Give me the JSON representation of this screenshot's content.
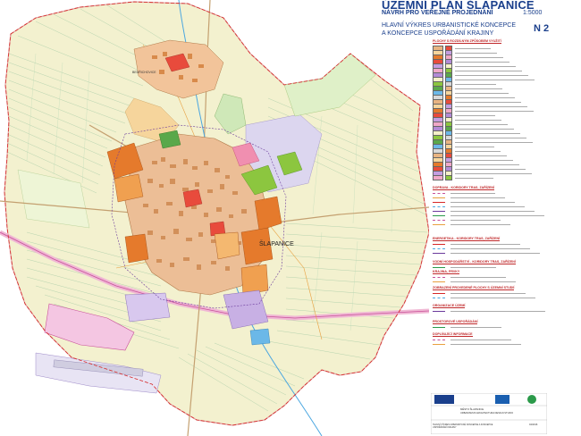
{
  "title": "ÚZEMNÍ PLÁN ŠLAPANICE",
  "subtitle": "NÁVRH PRO VEŘEJNÉ PROJEDNÁNÍ",
  "scale": "1:5000",
  "drawing_title_line1": "HLAVNÍ VÝKRES URBANISTICKÉ KONCEPCE",
  "drawing_title_line2": "A KONCEPCE USPOŘÁDÁNÍ KRAJINY",
  "sheet": "N 2",
  "map_labels": {
    "town": "ŠLAPANICE",
    "district": "BEDŘICHOVICE"
  },
  "legend": {
    "sections": [
      "PLOCHY S ROZDÍLNÝM ZPŮSOBEM VYUŽITÍ",
      "DOPRAVA - KORIDORY TRAS, ZAŘÍZENÍ",
      "ENERGETIKA - KORIDORY TRAS, ZAŘÍZENÍ",
      "VODNÍ HOSPODÁŘSTVÍ - KORIDORY TRAS, ZAŘÍZENÍ",
      "KRAJINA, PRVKY",
      "ZOBRAZENÍ PROVEDENÉ PLOCHY S ÚZEMNÍ STUDIÍ",
      "ORGANIZACE ÚZEMÍ",
      "PROSTOROVÉ USPOŘÁDÁNÍ",
      "DOPLŇUJÍCÍ INFORMACE"
    ],
    "colors": {
      "residential_urban": "#e8b482",
      "residential_rural": "#f6d59c",
      "mixed": "#e57a2c",
      "civic": "#e84b3c",
      "recreation": "#c49de0",
      "sport": "#f0a8c8",
      "industry": "#b38bd6",
      "agriculture": "#f5f0c8",
      "greenery": "#8cc63f",
      "forest": "#5aa84a",
      "water": "#6bb8e8",
      "transport": "#d8d8d8"
    }
  },
  "footer": {
    "project": "MĚSTO ŠLAPANICE",
    "firm": "URBANISMUS ARCHITEKTURA DESIGN STUDIO",
    "date": "04/2016",
    "note": "HLAVNÍ VÝKRES URBANISTICKÉ KONCEPCE A KONCEPCE USPOŘÁDÁNÍ KRAJINY"
  }
}
